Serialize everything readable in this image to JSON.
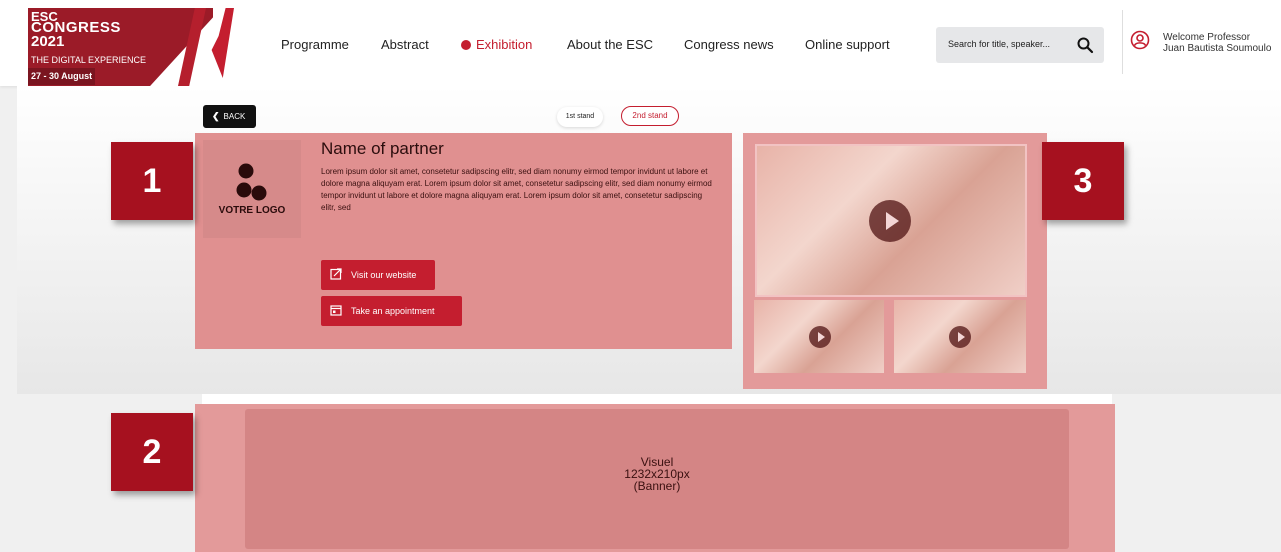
{
  "header": {
    "logo": {
      "line1": "ESC",
      "line2": "CONGRESS",
      "line3": "2021",
      "line4": "THE DIGITAL EXPERIENCE",
      "line5": "27 - 30 August"
    },
    "nav": [
      {
        "label": "Programme"
      },
      {
        "label": "Abstract"
      },
      {
        "label": "Exhibition",
        "active": true
      },
      {
        "label": "About the ESC"
      },
      {
        "label": "Congress news"
      },
      {
        "label": "Online support"
      }
    ],
    "search": {
      "placeholder": "Search for title, speaker..."
    },
    "user": {
      "welcome": "Welcome Professor",
      "name": "Juan Bautista Soumoulo"
    }
  },
  "stand": {
    "back_label": "BACK",
    "stand_tabs": [
      {
        "label": "1st stand"
      },
      {
        "label": "2nd stand",
        "active": true
      }
    ],
    "partner": {
      "logo_text": "VOTRE LOGO",
      "name": "Name of partner",
      "description": "Lorem ipsum dolor sit amet, consetetur sadipscing elitr, sed diam nonumy eirmod tempor invidunt ut labore et dolore magna aliquyam erat. Lorem ipsum dolor sit amet, consetetur sadipscing elitr, sed diam nonumy eirmod tempor invidunt ut labore et dolore magna aliquyam erat. Lorem ipsum dolor sit amet, consetetur sadipscing elitr, sed",
      "website_button": "Visit our website",
      "appointment_button": "Take an appointment"
    },
    "banner": {
      "line1": "Visuel",
      "line2": "1232x210px",
      "line3": "(Banner)"
    }
  },
  "badges": {
    "one": "1",
    "two": "2",
    "three": "3"
  },
  "colors": {
    "accent": "#c41e2f",
    "brand_dark": "#9b1b28",
    "overlay": "#e39a9a",
    "badge": "#a6111f"
  },
  "icons": [
    "search-icon",
    "user-icon",
    "back-chevron-icon",
    "external-link-icon",
    "calendar-icon",
    "play-icon",
    "partner-logo-icon"
  ]
}
